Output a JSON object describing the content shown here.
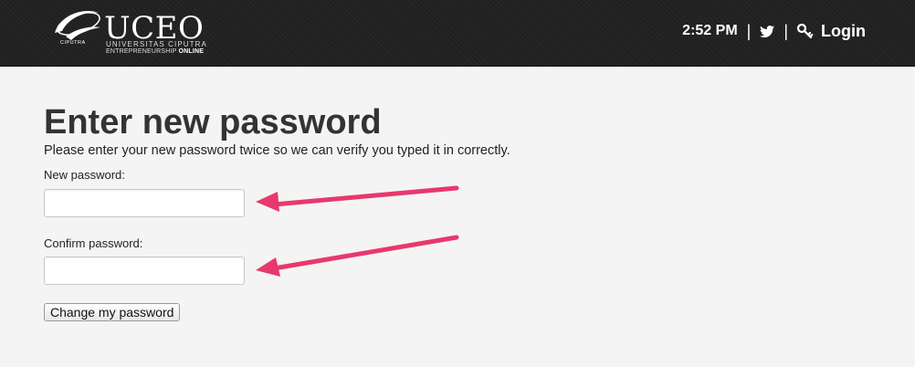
{
  "header": {
    "logo": {
      "emblem_text": "CIPUTRA",
      "title": "UCEO",
      "subtitle_line1": "UNIVERSITAS CIPUTRA",
      "subtitle_line2_prefix": "ENTREPRENEURSHIP ",
      "subtitle_line2_bold": "ONLINE"
    },
    "time": "2:52 PM",
    "separator": "|",
    "login_label": "Login",
    "icons": {
      "twitter": "twitter-bird-icon",
      "login": "key-icon"
    }
  },
  "form": {
    "title": "Enter new password",
    "description": "Please enter your new password twice so we can verify you typed it in correctly.",
    "new_password": {
      "label": "New password:",
      "value": "",
      "placeholder": ""
    },
    "confirm_password": {
      "label": "Confirm password:",
      "value": "",
      "placeholder": ""
    },
    "submit_label": "Change my password"
  },
  "annotations": {
    "arrow_color": "#e8386d"
  }
}
